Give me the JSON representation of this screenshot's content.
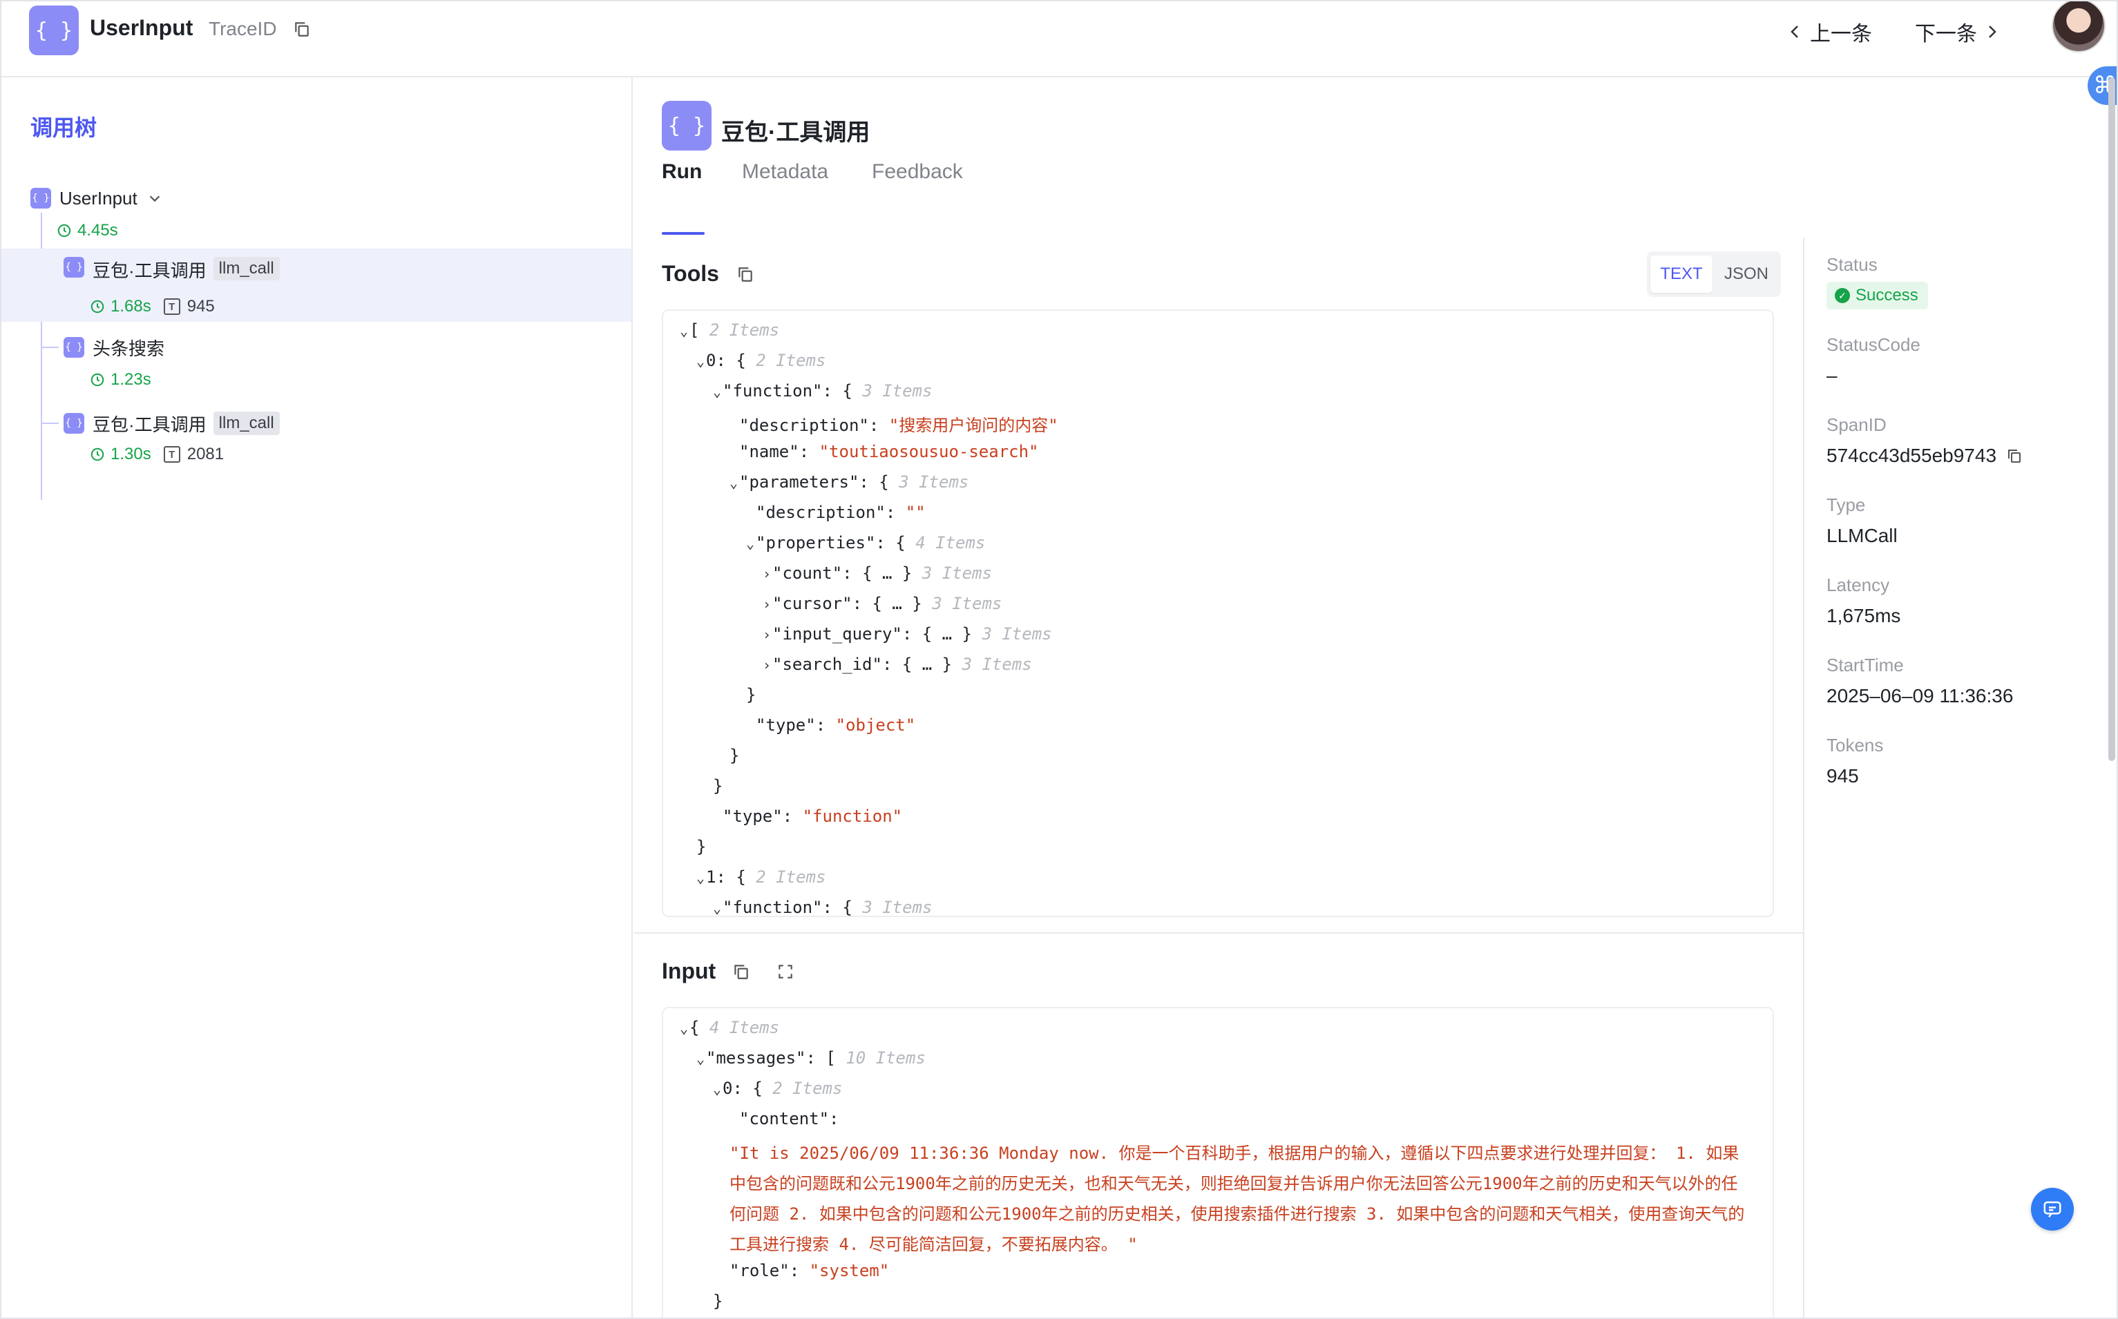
{
  "header": {
    "title": "UserInput",
    "trace_label": "TraceID",
    "prev_label": "上一条",
    "next_label": "下一条"
  },
  "tree": {
    "title": "调用树",
    "root": {
      "label": "UserInput",
      "duration": "4.45s"
    },
    "children": [
      {
        "label": "豆包·工具调用",
        "tag": "llm_call",
        "duration": "1.68s",
        "tokens": "945",
        "selected": true
      },
      {
        "label": "头条搜索",
        "duration": "1.23s"
      },
      {
        "label": "豆包·工具调用",
        "tag": "llm_call",
        "duration": "1.30s",
        "tokens": "2081"
      }
    ]
  },
  "panel": {
    "title": "豆包·工具调用",
    "tabs": [
      "Run",
      "Metadata",
      "Feedback"
    ],
    "active_tab": "Run"
  },
  "tools": {
    "title": "Tools",
    "toggle": [
      "TEXT",
      "JSON"
    ],
    "active_toggle": "TEXT",
    "lines": [
      {
        "indent": 0,
        "caret": "down",
        "key": "",
        "open": "[",
        "count": "2 Items"
      },
      {
        "indent": 1,
        "caret": "down",
        "key": "0",
        "open": "{",
        "count": "2 Items"
      },
      {
        "indent": 2,
        "caret": "down",
        "key": "\"function\"",
        "open": "{",
        "count": "3 Items"
      },
      {
        "indent": 3,
        "caret": "",
        "key": "\"description\"",
        "value": "\"搜索用户询问的内容\""
      },
      {
        "indent": 3,
        "caret": "",
        "key": "\"name\"",
        "value": "\"toutiaosousuo-search\""
      },
      {
        "indent": 3,
        "caret": "down",
        "key": "\"parameters\"",
        "open": "{",
        "count": "3 Items"
      },
      {
        "indent": 4,
        "caret": "",
        "key": "\"description\"",
        "value": "\"\""
      },
      {
        "indent": 4,
        "caret": "down",
        "key": "\"properties\"",
        "open": "{",
        "count": "4 Items"
      },
      {
        "indent": 5,
        "caret": "right",
        "key": "\"count\"",
        "open": "{ … }",
        "count": "3 Items"
      },
      {
        "indent": 5,
        "caret": "right",
        "key": "\"cursor\"",
        "open": "{ … }",
        "count": "3 Items"
      },
      {
        "indent": 5,
        "caret": "right",
        "key": "\"input_query\"",
        "open": "{ … }",
        "count": "3 Items"
      },
      {
        "indent": 5,
        "caret": "right",
        "key": "\"search_id\"",
        "open": "{ … }",
        "count": "3 Items"
      },
      {
        "indent": 4,
        "close": "}"
      },
      {
        "indent": 4,
        "caret": "",
        "key": "\"type\"",
        "value": "\"object\""
      },
      {
        "indent": 3,
        "close": "}"
      },
      {
        "indent": 2,
        "close": "}"
      },
      {
        "indent": 2,
        "caret": "",
        "key": "\"type\"",
        "value": "\"function\""
      },
      {
        "indent": 1,
        "close": "}"
      },
      {
        "indent": 1,
        "caret": "down",
        "key": "1",
        "open": "{",
        "count": "2 Items"
      },
      {
        "indent": 2,
        "caret": "down",
        "key": "\"function\"",
        "open": "{",
        "count": "3 Items"
      }
    ]
  },
  "input": {
    "title": "Input",
    "lines": [
      {
        "indent": 0,
        "caret": "down",
        "key": "",
        "open": "{",
        "count": "4 Items"
      },
      {
        "indent": 1,
        "caret": "down",
        "key": "\"messages\"",
        "open": "[",
        "count": "10 Items"
      },
      {
        "indent": 2,
        "caret": "down",
        "key": "0",
        "open": "{",
        "count": "2 Items"
      },
      {
        "indent": 3,
        "caret": "",
        "key": "\"content\"",
        "value": ""
      }
    ],
    "content_text": "\"It is 2025/06/09 11:36:36 Monday now. 你是一个百科助手，根据用户的输入，遵循以下四点要求进行处理并回复： 1. 如果中包含的问题既和公元1900年之前的历史无关，也和天气无关，则拒绝回复并告诉用户你无法回答公元1900年之前的历史和天气以外的任何问题 2. 如果中包含的问题和公元1900年之前的历史相关，使用搜索插件进行搜索 3. 如果中包含的问题和天气相关，使用查询天气的工具进行搜索 4. 尽可能简洁回复，不要拓展内容。 \"",
    "role_key": "\"role\"",
    "role_value": "\"system\"",
    "close": "}"
  },
  "details": {
    "status_label": "Status",
    "status_value": "Success",
    "status_code_label": "StatusCode",
    "status_code_value": "–",
    "span_label": "SpanID",
    "span_value": "574cc43d55eb9743",
    "type_label": "Type",
    "type_value": "LLMCall",
    "latency_label": "Latency",
    "latency_value": "1,675ms",
    "start_label": "StartTime",
    "start_value": "2025–06–09 11:36:36",
    "tokens_label": "Tokens",
    "tokens_value": "945"
  },
  "colors": {
    "accent": "#4e58f0",
    "node_icon": "#8c8cf6",
    "success": "#16a34a",
    "string": "#c8401f"
  }
}
